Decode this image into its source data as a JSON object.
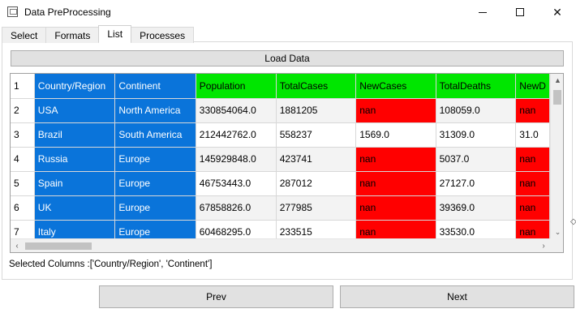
{
  "window": {
    "title": "Data PreProcessing"
  },
  "tabs": [
    {
      "label": "Select",
      "active": false
    },
    {
      "label": "Formats",
      "active": false
    },
    {
      "label": "List",
      "active": true
    },
    {
      "label": "Processes",
      "active": false
    }
  ],
  "load_button": {
    "label": "Load Data"
  },
  "table": {
    "row_numbers": [
      "1",
      "2",
      "3",
      "4",
      "5",
      "6",
      "7"
    ],
    "rows": [
      [
        "Country/Region",
        "Continent",
        "Population",
        "TotalCases",
        "NewCases",
        "TotalDeaths",
        "NewD"
      ],
      [
        "USA",
        "North America",
        "330854064.0",
        "1881205",
        "nan",
        "108059.0",
        "nan"
      ],
      [
        "Brazil",
        "South America",
        "212442762.0",
        "558237",
        "1569.0",
        "31309.0",
        "31.0"
      ],
      [
        "Russia",
        "Europe",
        "145929848.0",
        "423741",
        "nan",
        "5037.0",
        "nan"
      ],
      [
        "Spain",
        "Europe",
        "46753443.0",
        "287012",
        "nan",
        "27127.0",
        "nan"
      ],
      [
        "UK",
        "Europe",
        "67858826.0",
        "277985",
        "nan",
        "39369.0",
        "nan"
      ],
      [
        "Italy",
        "Europe",
        "60468295.0",
        "233515",
        "nan",
        "33530.0",
        "nan"
      ]
    ],
    "colors": {
      "selected": "#0a74da",
      "header": "#00e600",
      "missing": "#ff0000"
    }
  },
  "selected_columns_text": "Selected Columns :['Country/Region', 'Continent']",
  "nav": {
    "prev_label": "Prev",
    "next_label": "Next"
  }
}
